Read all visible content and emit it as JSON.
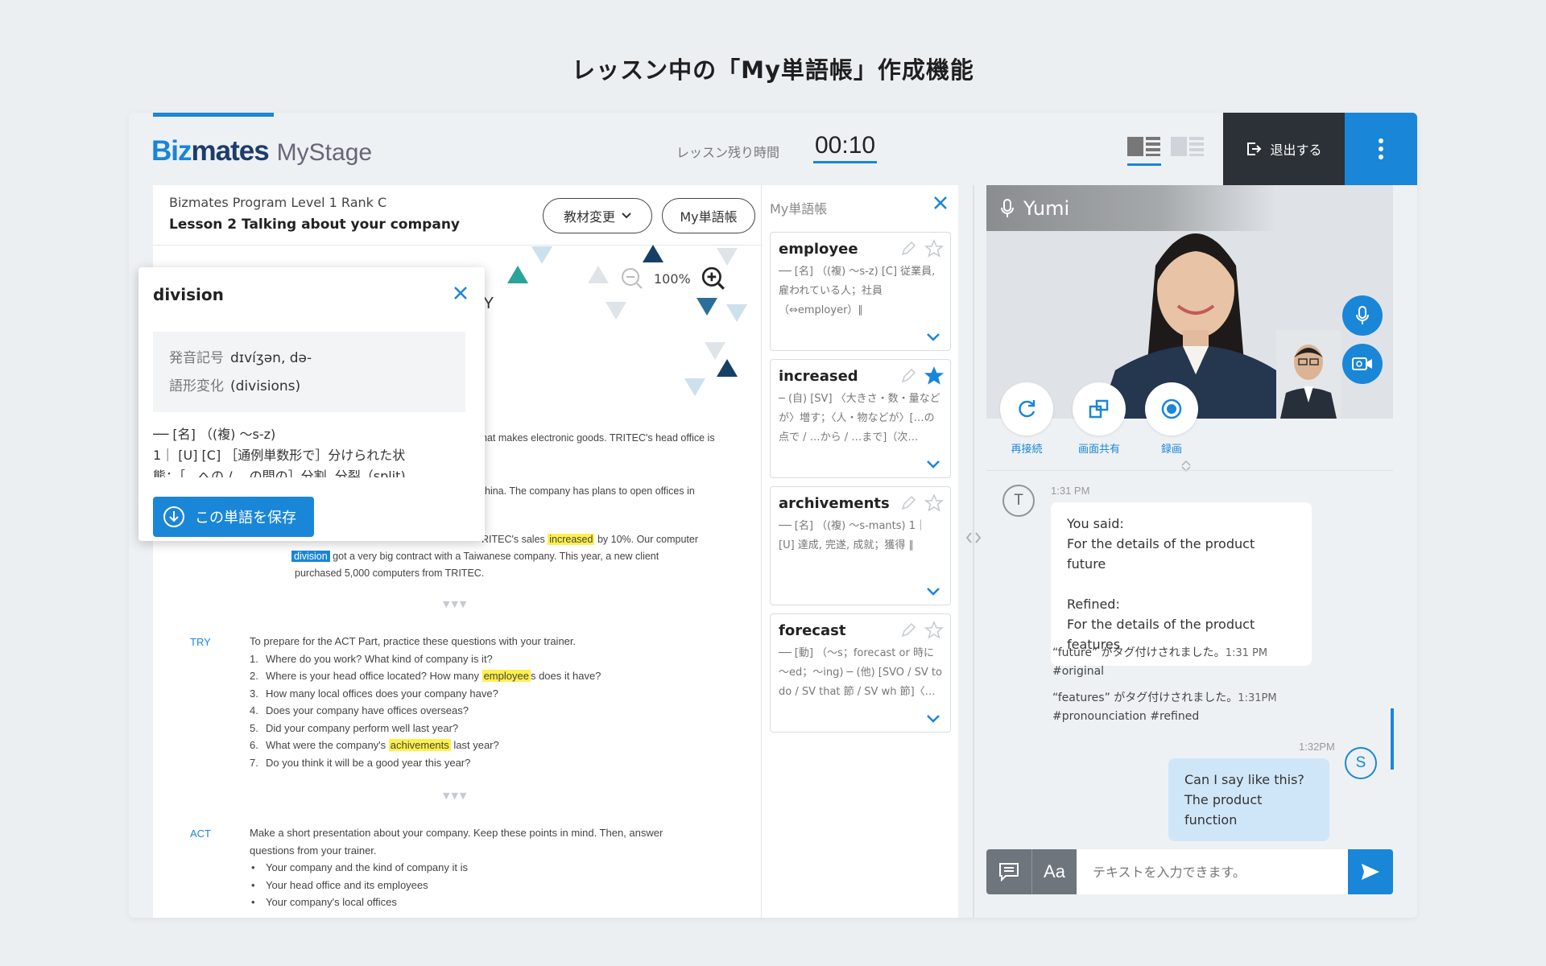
{
  "page_heading": "レッスン中の「My単語帳」作成機能",
  "header": {
    "logo_main_a": "Biz",
    "logo_main_b": "mates",
    "logo_sub": "MyStage",
    "timer_label": "レッスン残り時間",
    "timer_value": "00:10",
    "exit_label": "退出する"
  },
  "material": {
    "program": "Bizmates Program  Level 1 Rank C",
    "lesson": "Lesson 2 Talking about your company",
    "change_button": "教材変更",
    "vocab_button": "My単語帳",
    "zoom": "100%",
    "title_fragment": "Y",
    "p1": "hat makes electronic goods. TRITEC's head office is",
    "p2": "hina. The company has plans to open offices in",
    "p3_pre": "RITEC's sales ",
    "p3_hl": "increased",
    "p3_post": " by 10%. Our computer",
    "p4_hl": "division",
    "p4_post": " got a very big contract with a Taiwanese company. This year, a new client",
    "p5": "purchased 5,000 computers from TRITEC.",
    "dots": "▼▼▼",
    "try_label": "TRY",
    "try_intro": "To prepare for the ACT Part, practice these questions with your trainer.",
    "try_q1": "Where do you work? What kind of company is it?",
    "try_q2_pre": "Where is your head office located? How many ",
    "try_q2_hl": "employee",
    "try_q2_post": "s does it have?",
    "try_q3": "How many local offices does your company have?",
    "try_q4": "Does your company have offices overseas?",
    "try_q5": "Did your company perform well last year?",
    "try_q6_pre": "What were the company's ",
    "try_q6_hl": "achivements",
    "try_q6_post": " last year?",
    "try_q7": "Do you think it will be a good year this year?",
    "act_label": "ACT",
    "act_intro_1": "Make a short presentation about your company. Keep these points in mind. Then, answer",
    "act_intro_2": "questions from your trainer.",
    "act_p1": "Your company and the kind of company it is",
    "act_p2": "Your head office and its employees",
    "act_p3": "Your company's local offices"
  },
  "popup": {
    "word": "division",
    "pron_label": "発音記号",
    "pron_value": "dɪvíʒən, də-",
    "form_label": "語形変化",
    "form_value": "(divisions)",
    "def_line1": "── [名] （(複) ～s-z)",
    "def_line2": "1｜ [U] [C] ［通例単数形で］分けられた状",
    "def_line3": "態；［…への / …の間の］分割, 分裂（split)",
    "save_label": "この単語を保存"
  },
  "vocab": {
    "title": "My単語帳",
    "cards": [
      {
        "word": "employee",
        "def": "── [名] （(複) ～s-z) [C] 従業員, 雇われている人；社員（⇔employer）∥",
        "starred": false
      },
      {
        "word": "increased",
        "def": "─ (自) [SV] 〈大きさ・数・量などが〉増す；〈人・物などが〉[…の点で / …から / …まで]（次…",
        "starred": true
      },
      {
        "word": "archivements",
        "def": "── [名] （(複) ～s-mants) 1｜ [U] 達成, 完遂, 成就；獲得 ∥",
        "starred": false
      },
      {
        "word": "forecast",
        "def": "── [動] （～s；forecast or 時に～ed；～ing) ─ (他) [SVO / SV to do / SV that 節 / SV wh 節]〈…",
        "starred": false
      }
    ]
  },
  "video": {
    "name": "Yumi",
    "reconnect": "再接続",
    "share": "画面共有",
    "record": "録画"
  },
  "chat": {
    "t_avatar": "T",
    "t_time": "1:31 PM",
    "msg1_l1": "You said:",
    "msg1_l2": "For the details of the product future",
    "msg1_l3": "Refined:",
    "msg1_l4": "For the details of the product features",
    "tag1_text": "“future” がタグ付けされました。",
    "tag1_time": "1:31 PM",
    "tag1_tags": "#original",
    "tag2_text": "“features” がタグ付けされました。",
    "tag2_time": "1:31PM",
    "tag2_tags": "#pronounciation  #refined",
    "me_time": "1:32PM",
    "s_avatar": "S",
    "me_l1": "Can I say like this?",
    "me_l2": "The product function",
    "font_button": "Aa",
    "input_placeholder": "テキストを入力できます。"
  }
}
